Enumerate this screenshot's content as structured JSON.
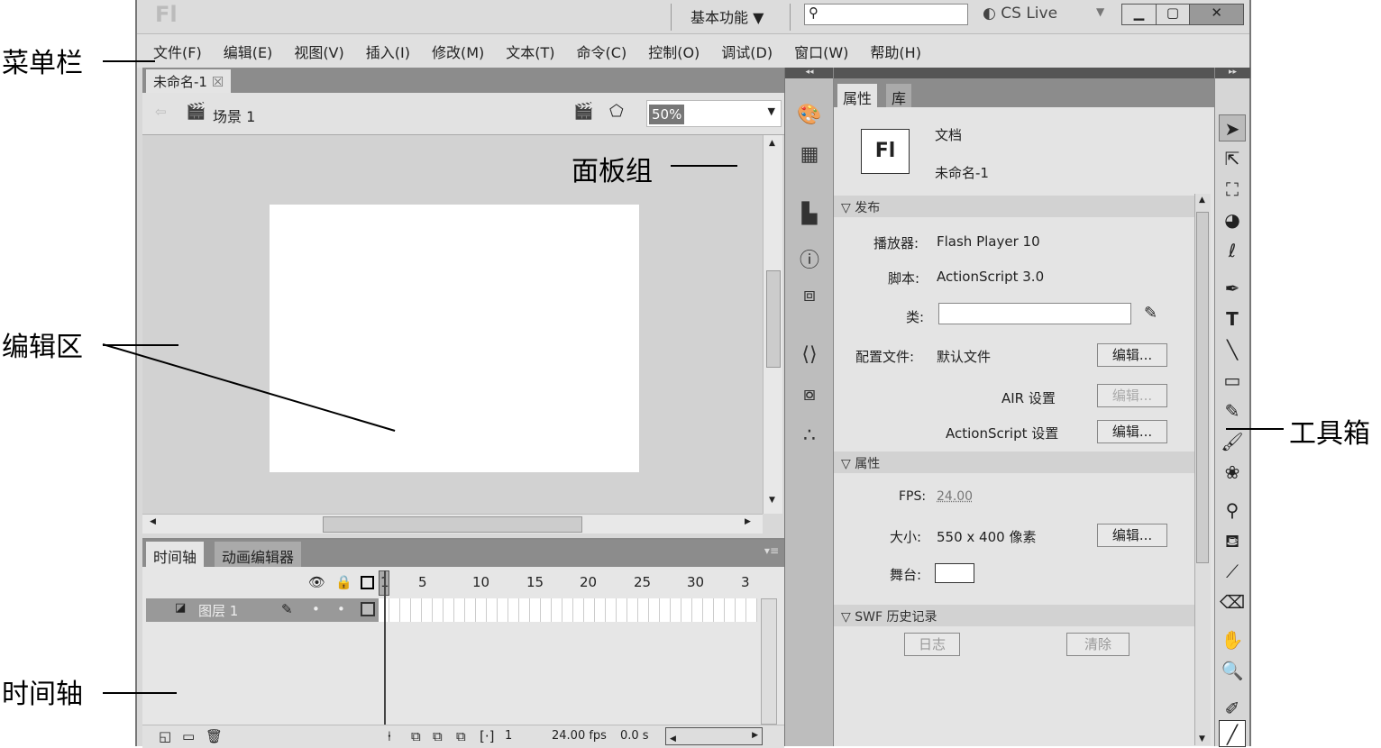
{
  "title_bar": {
    "logo": "Fl",
    "workspace": "基本功能 ▼",
    "search_placeholder": "",
    "cs_live": "CS Live",
    "cs_live_arrow": "▼"
  },
  "menu": [
    "文件(F)",
    "编辑(E)",
    "视图(V)",
    "插入(I)",
    "修改(M)",
    "文本(T)",
    "命令(C)",
    "控制(O)",
    "调试(D)",
    "窗口(W)",
    "帮助(H)"
  ],
  "document_tab": {
    "name": "未命名-1",
    "close": "☒"
  },
  "edit_bar": {
    "scene": "场景 1",
    "zoom": "50%"
  },
  "timeline": {
    "tabs": [
      "时间轴",
      "动画编辑器"
    ],
    "layer": "图层 1",
    "frame_numbers": [
      "1",
      "5",
      "10",
      "15",
      "20",
      "25",
      "30",
      "3"
    ],
    "current_frame": "1",
    "fps": "24.00 fps",
    "time": "0.0 s"
  },
  "properties": {
    "tabs": [
      "属性",
      "库"
    ],
    "doc_icon": "Fl",
    "doc_type": "文档",
    "doc_name": "未命名-1",
    "publish_section": "发布",
    "player_label": "播放器:",
    "player": "Flash Player 10",
    "script_label": "脚本:",
    "script": "ActionScript 3.0",
    "class_label": "类:",
    "profile_label": "配置文件:",
    "profile": "默认文件",
    "edit": "编辑...",
    "air_label": "AIR 设置",
    "as_label": "ActionScript 设置",
    "props_section": "属性",
    "fps_label": "FPS:",
    "fps": "24.00",
    "size_label": "大小:",
    "size": "550 x 400 像素",
    "stage_label": "舞台:",
    "swf_section": "SWF 历史记录",
    "log": "日志",
    "clear": "清除"
  },
  "annotations": {
    "menubar": "菜单栏",
    "editarea": "编辑区",
    "timeline": "时间轴",
    "panels": "面板组",
    "toolbox": "工具箱"
  }
}
